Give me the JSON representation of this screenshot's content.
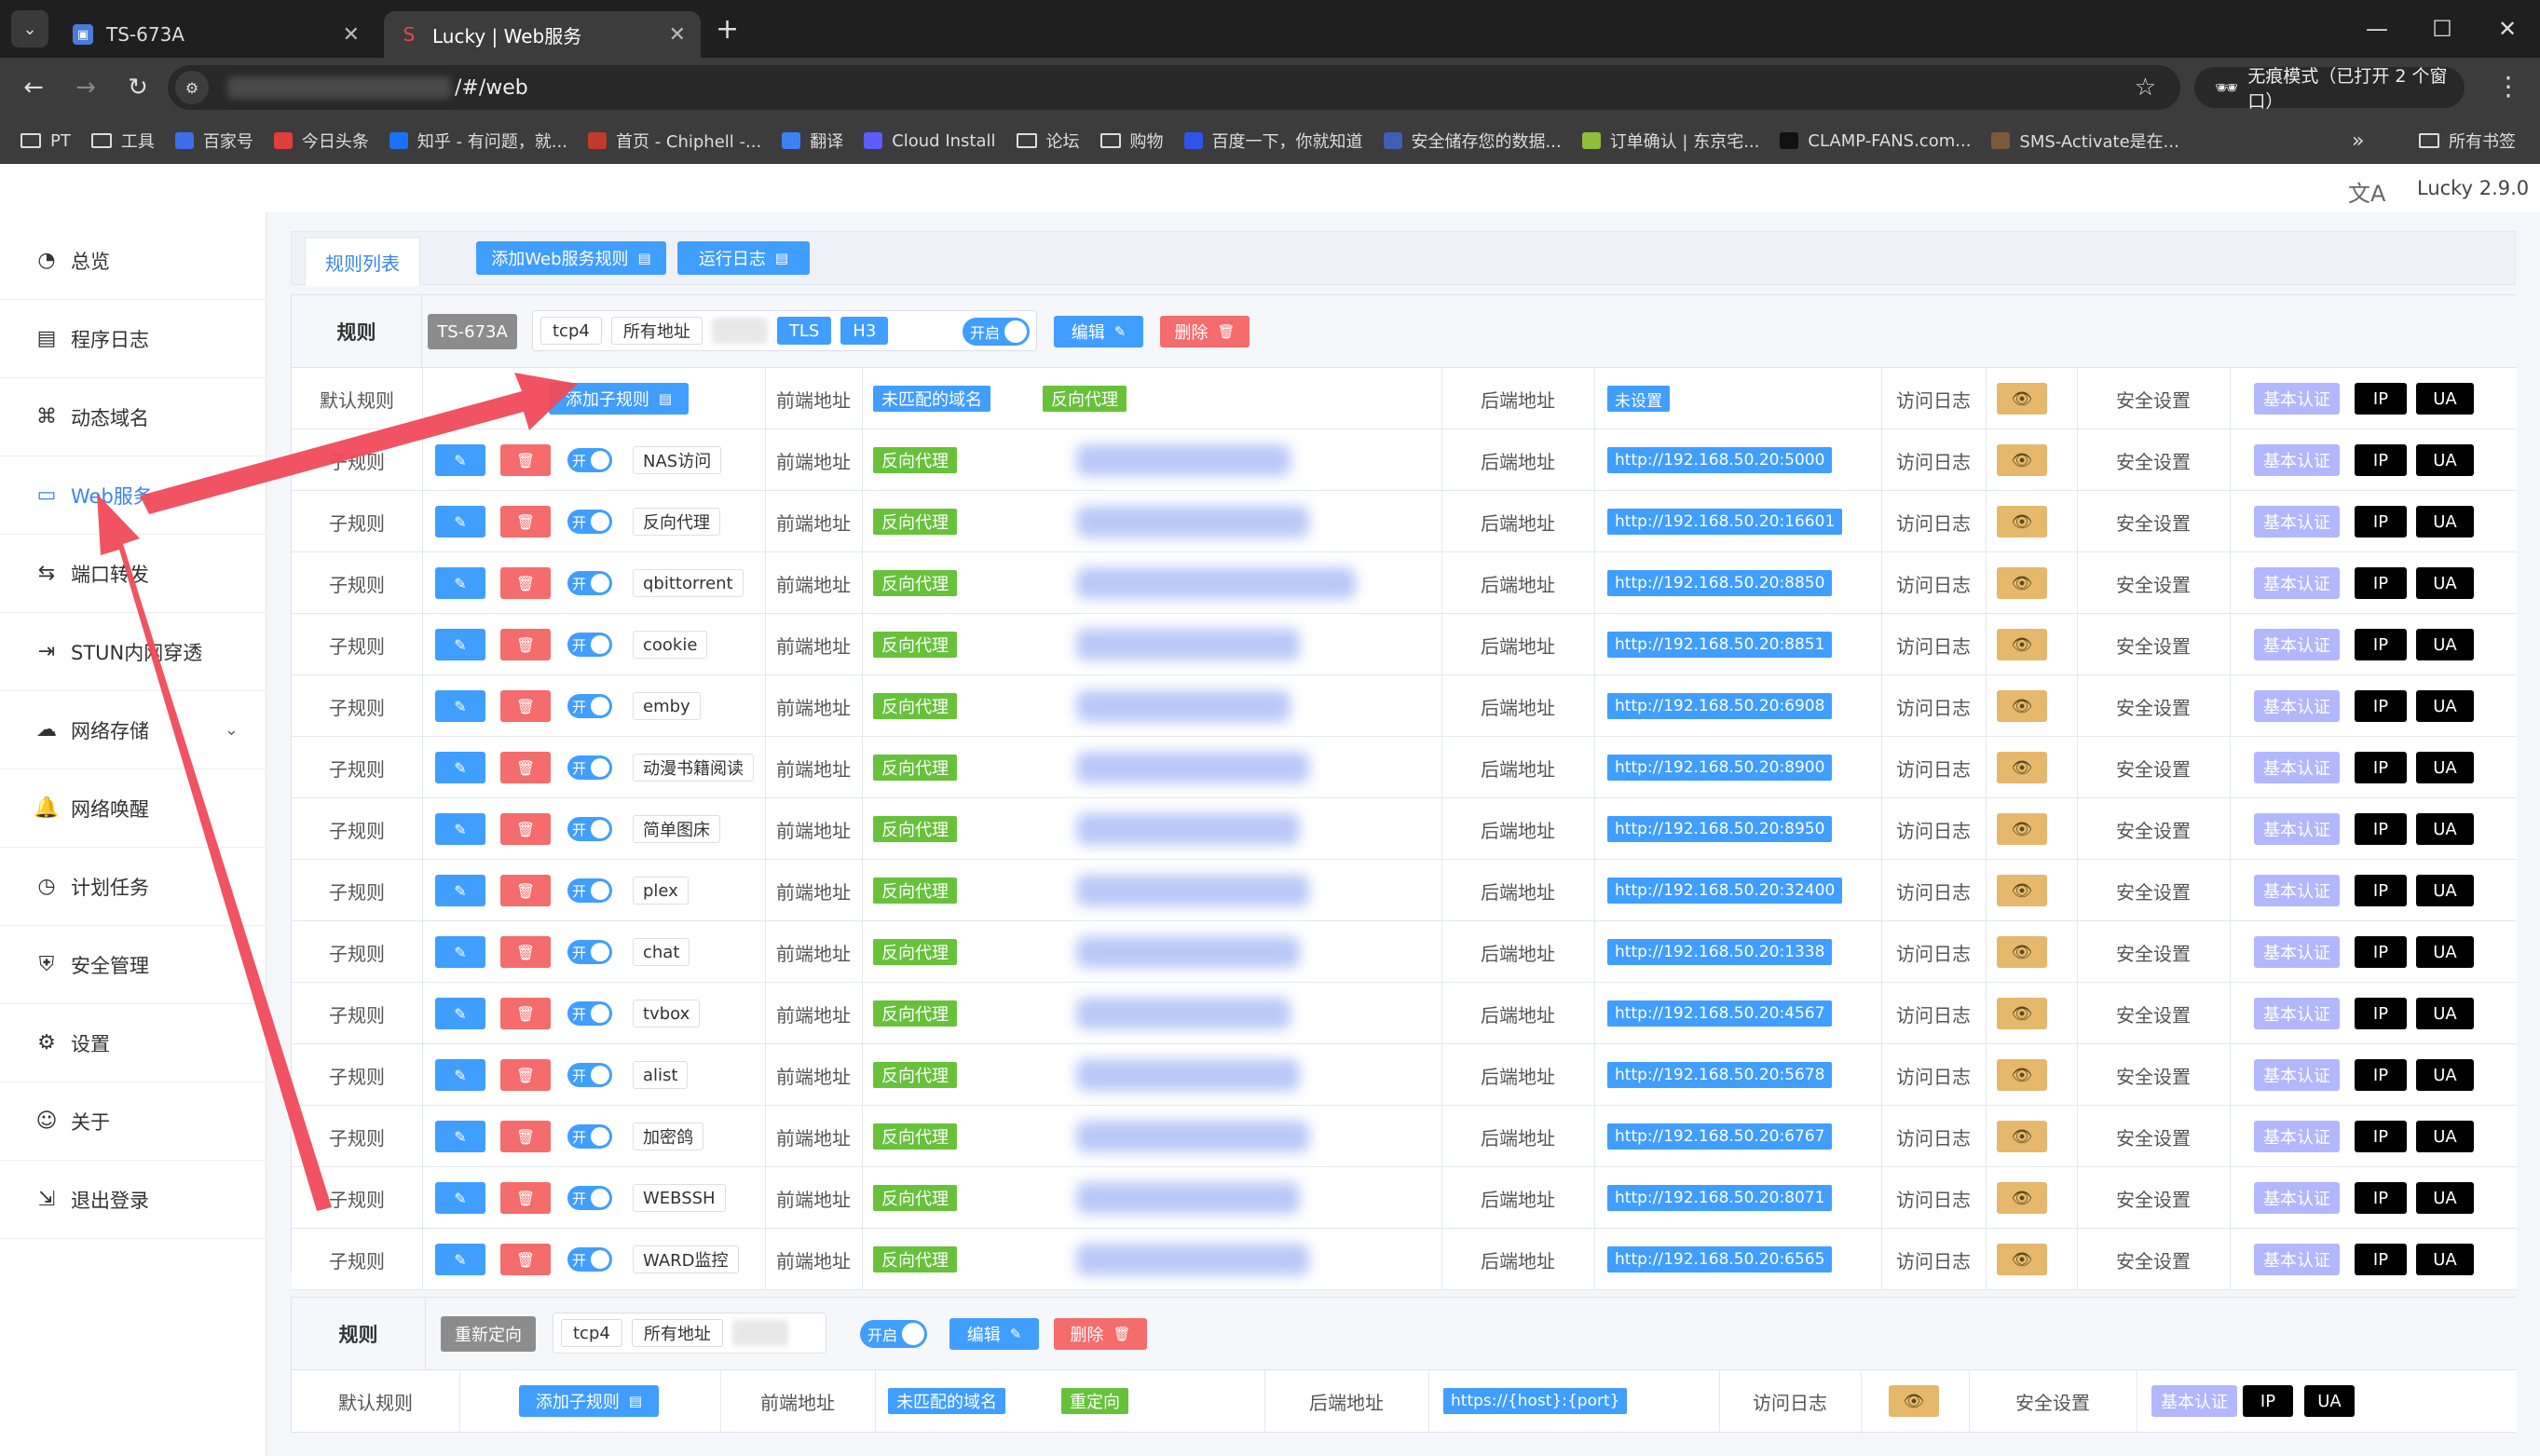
{
  "browser": {
    "tabs": [
      {
        "title": "TS-673A",
        "active": false,
        "icon": "window-icon",
        "color": "#4a7bd8"
      },
      {
        "title": "Lucky | Web服务",
        "active": true,
        "icon": "lucky-icon",
        "color": "#e84a4a"
      }
    ],
    "url_suffix": "/#/web",
    "incognito_label": "无痕模式（已打开 2 个窗口）",
    "bookmarks": [
      {
        "label": "PT",
        "type": "folder"
      },
      {
        "label": "工具",
        "type": "folder"
      },
      {
        "label": "百家号",
        "type": "site",
        "color": "#3b6ee8"
      },
      {
        "label": "今日头条",
        "type": "site",
        "color": "#e33c3c"
      },
      {
        "label": "知乎 - 有问题，就...",
        "type": "site",
        "color": "#1772f6"
      },
      {
        "label": "首页 - Chiphell -...",
        "type": "site",
        "color": "#c23a2b"
      },
      {
        "label": "翻译",
        "type": "site",
        "color": "#3b82f6"
      },
      {
        "label": "Cloud Install",
        "type": "site",
        "color": "#5c5cff"
      },
      {
        "label": "论坛",
        "type": "folder"
      },
      {
        "label": "购物",
        "type": "folder"
      },
      {
        "label": "百度一下，你就知道",
        "type": "site",
        "color": "#2f54eb"
      },
      {
        "label": "安全储存您的数据...",
        "type": "site",
        "color": "#3f5fb5"
      },
      {
        "label": "订单确认 | 东京宅...",
        "type": "site",
        "color": "#8fbf3a"
      },
      {
        "label": "CLAMP-FANS.com...",
        "type": "site",
        "color": "#111111"
      },
      {
        "label": "SMS-Activate是在...",
        "type": "site",
        "color": "#7a5a3a"
      }
    ],
    "all_bookmarks": "所有书签"
  },
  "app": {
    "version": "Lucky 2.9.0",
    "sidebar": [
      {
        "label": "总览",
        "icon": "dashboard-icon",
        "active": false
      },
      {
        "label": "程序日志",
        "icon": "log-icon",
        "active": false
      },
      {
        "label": "动态域名",
        "icon": "ddns-icon",
        "active": false
      },
      {
        "label": "Web服务",
        "icon": "web-service-icon",
        "active": true
      },
      {
        "label": "端口转发",
        "icon": "port-forward-icon",
        "active": false
      },
      {
        "label": "STUN内网穿透",
        "icon": "stun-icon",
        "active": false
      },
      {
        "label": "网络存储",
        "icon": "cloud-storage-icon",
        "active": false,
        "expandable": true
      },
      {
        "label": "网络唤醒",
        "icon": "bell-icon",
        "active": false
      },
      {
        "label": "计划任务",
        "icon": "clock-icon",
        "active": false
      },
      {
        "label": "安全管理",
        "icon": "shield-icon",
        "active": false
      },
      {
        "label": "设置",
        "icon": "gear-icon",
        "active": false
      },
      {
        "label": "关于",
        "icon": "about-icon",
        "active": false
      },
      {
        "label": "退出登录",
        "icon": "logout-icon",
        "active": false
      }
    ],
    "tabs": {
      "rule_list": "规则列表",
      "add_web_rule": "添加Web服务规则",
      "run_log": "运行日志"
    },
    "labels": {
      "rule": "规则",
      "default_rule": "默认规则",
      "sub_rule": "子规则",
      "add_sub_rule": "添加子规则",
      "frontend": "前端地址",
      "backend": "后端地址",
      "access_log": "访问日志",
      "security": "安全设置",
      "basic_auth": "基本认证",
      "ip": "IP",
      "ua": "UA",
      "on": "开启",
      "on_short": "开",
      "edit": "编辑",
      "delete": "删除",
      "reverse_proxy": "反向代理",
      "unmatched_domain": "未匹配的域名",
      "redirect": "重定向"
    },
    "block1": {
      "name": "TS-673A",
      "protocol": "tcp4",
      "address": "所有地址",
      "badges": [
        "TLS",
        "H3"
      ],
      "default_backend": "未设置",
      "subrules": [
        {
          "name": "NAS访问",
          "backend": "http://192.168.50.20:5000"
        },
        {
          "name": "反向代理",
          "backend": "http://192.168.50.20:16601"
        },
        {
          "name": "qbittorrent",
          "backend": "http://192.168.50.20:8850"
        },
        {
          "name": "cookie",
          "backend": "http://192.168.50.20:8851"
        },
        {
          "name": "emby",
          "backend": "http://192.168.50.20:6908"
        },
        {
          "name": "动漫书籍阅读",
          "backend": "http://192.168.50.20:8900"
        },
        {
          "name": "简单图床",
          "backend": "http://192.168.50.20:8950"
        },
        {
          "name": "plex",
          "backend": "http://192.168.50.20:32400"
        },
        {
          "name": "chat",
          "backend": "http://192.168.50.20:1338"
        },
        {
          "name": "tvbox",
          "backend": "http://192.168.50.20:4567"
        },
        {
          "name": "alist",
          "backend": "http://192.168.50.20:5678"
        },
        {
          "name": "加密鸽",
          "backend": "http://192.168.50.20:6767"
        },
        {
          "name": "WEBSSH",
          "backend": "http://192.168.50.20:8071"
        },
        {
          "name": "WARD监控",
          "backend": "http://192.168.50.20:6565"
        }
      ]
    },
    "block2": {
      "name": "重新定向",
      "protocol": "tcp4",
      "address": "所有地址",
      "default_backend": "https://{host}:{port}"
    }
  },
  "colors": {
    "accent": "#409eff",
    "danger": "#f56c6c",
    "success": "#67c23a",
    "arrow": "#f04a5a"
  }
}
